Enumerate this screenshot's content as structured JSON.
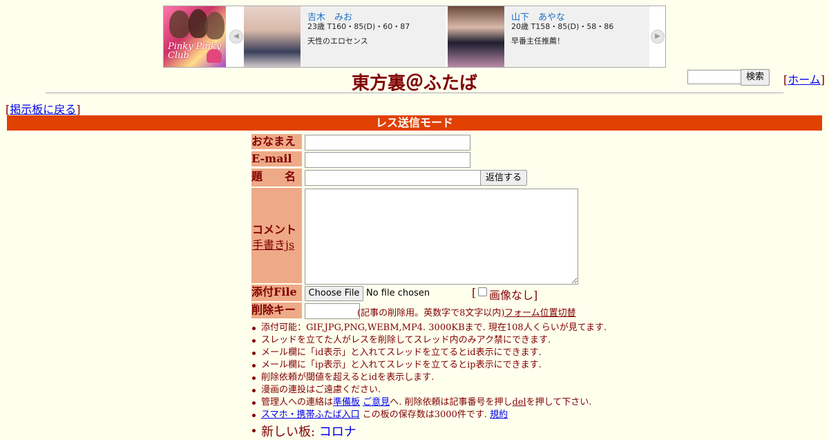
{
  "ad": {
    "logo_text": "Pinky Pinky Club",
    "card1": {
      "name": "吉木　みお",
      "spec": "23歳 T160・85(D)・60・87",
      "desc": "天性のエロセンス"
    },
    "card2": {
      "name": "山下　あやな",
      "spec": "20歳 T158・85(D)・58・86",
      "desc": "早番主任推薦！"
    },
    "arrow_left": "◀",
    "arrow_right": "▶"
  },
  "header": {
    "title": "東方裏＠ふたば",
    "search_button": "検索",
    "home_open": "[",
    "home_link": "ホーム",
    "home_close": "]"
  },
  "nav": {
    "back_open": "[",
    "back_link": "掲示板に戻る",
    "back_close": "]"
  },
  "mode_bar": "レス送信モード",
  "form": {
    "name_label": "おなまえ",
    "email_label": "E-mail",
    "subject_label": "題　　名",
    "submit_button": "返信する",
    "comment_label": "コメント",
    "handwriting_link": "手書きjs",
    "file_label": "添付File",
    "choose_file_button": "Choose File",
    "no_file_text": "No file chosen",
    "no_image_open": "[",
    "no_image_label": "画像なし]",
    "delkey_label": "削除キー",
    "delkey_hint": "(記事の削除用。英数字で8文字以内)",
    "form_toggle_link": "フォーム位置切替"
  },
  "notes": {
    "n1": "添付可能：GIF,JPG,PNG,WEBM,MP4. 3000KBまで. 現在108人くらいが見てます.",
    "n2": "スレッドを立てた人がレスを削除してスレッド内のみアク禁にできます.",
    "n3": "メール欄に「id表示」と入れてスレッドを立てるとid表示にできます.",
    "n4": "メール欄に「ip表示」と入れてスレッドを立てるとip表示にできます.",
    "n5": "削除依頼が閾値を超えるとidを表示します.",
    "n6": "漫画の連投はご遠慮ください.",
    "n7_a": "管理人への連絡は",
    "n7_link1": "準備板",
    "n7_link2": "ご意見",
    "n7_b": "へ. 削除依頼は記事番号を押し",
    "n7_link3": "del",
    "n7_c": "を押して下さい.",
    "n8_link1": "スマホ・携帯ふたば入口",
    "n8_b": " この板の保存数は3000件です. ",
    "n8_link2": "規約",
    "n9_a": "新しい板: ",
    "n9_link": "コロナ"
  },
  "colors": {
    "background": "#FFFFEE",
    "text": "#800000",
    "mode_bar": "#E04000",
    "label_bg": "#EEAA88",
    "link": "#0000EE"
  }
}
